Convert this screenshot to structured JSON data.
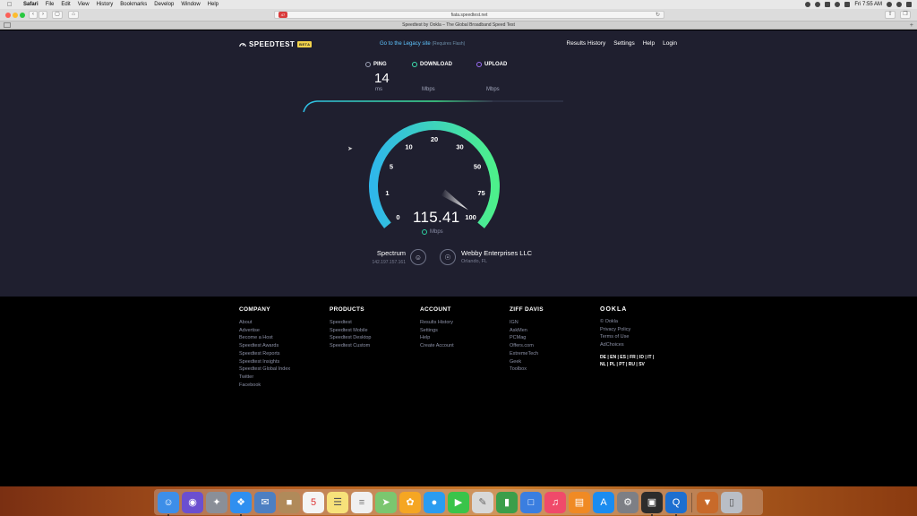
{
  "menubar": {
    "app_name": "Safari",
    "items": [
      "File",
      "Edit",
      "View",
      "History",
      "Bookmarks",
      "Develop",
      "Window",
      "Help"
    ],
    "clock": "Fri 7:55 AM"
  },
  "browser": {
    "address": "fiata.speedtest.net",
    "badge": "47",
    "tab_title": "Speedtest by Ookla – The Global Broadband Speed Test"
  },
  "header": {
    "logo": "SPEEDTEST",
    "beta": "BETA",
    "legacy_link": "Go to the Legacy site",
    "legacy_note": "(Requires Flash)",
    "nav": [
      "Results History",
      "Settings",
      "Help",
      "Login"
    ]
  },
  "metrics": {
    "ping_label": "PING",
    "ping_value": "14",
    "ping_unit": "ms",
    "download_label": "DOWNLOAD",
    "download_unit": "Mbps",
    "upload_label": "UPLOAD",
    "upload_unit": "Mbps"
  },
  "gauge": {
    "ticks": [
      "0",
      "1",
      "5",
      "10",
      "20",
      "30",
      "50",
      "75",
      "100"
    ],
    "current_value": "115.41",
    "unit": "Mbps",
    "needle_fraction": 0.98
  },
  "connection": {
    "isp_name": "Spectrum",
    "isp_ip": "142.197.157.161",
    "server_name": "Webby Enterprises LLC",
    "server_location": "Orlando, FL"
  },
  "footer": {
    "columns": [
      {
        "title": "COMPANY",
        "links": [
          "About",
          "Advertise",
          "Become a Host",
          "Speedtest Awards",
          "Speedtest Reports",
          "Speedtest Insights",
          "Speedtest Global Index",
          "Twitter",
          "Facebook"
        ]
      },
      {
        "title": "PRODUCTS",
        "links": [
          "Speedtest",
          "Speedtest Mobile",
          "Speedtest Desktop",
          "Speedtest Custom"
        ]
      },
      {
        "title": "ACCOUNT",
        "links": [
          "Results History",
          "Settings",
          "Help",
          "Create Account"
        ]
      },
      {
        "title": "ZIFF DAVIS",
        "links": [
          "IGN",
          "AskMen",
          "PCMag",
          "Offers.com",
          "ExtremeTech",
          "Geek",
          "Toolbox"
        ]
      }
    ],
    "ookla": {
      "logo": "OOKLA",
      "links": [
        "© Ookla",
        "Privacy Policy",
        "Terms of Use",
        "AdChoices"
      ],
      "languages_line1": "DE | EN | ES | FR | ID | IT |",
      "languages_line2": "NL | PL | PT | RU | SV"
    }
  },
  "colors": {
    "page_bg": "#1f1f2f",
    "accent_cyan": "#2fc0e8",
    "accent_green": "#3ee28e",
    "upload_purple": "#9a6cf5"
  }
}
